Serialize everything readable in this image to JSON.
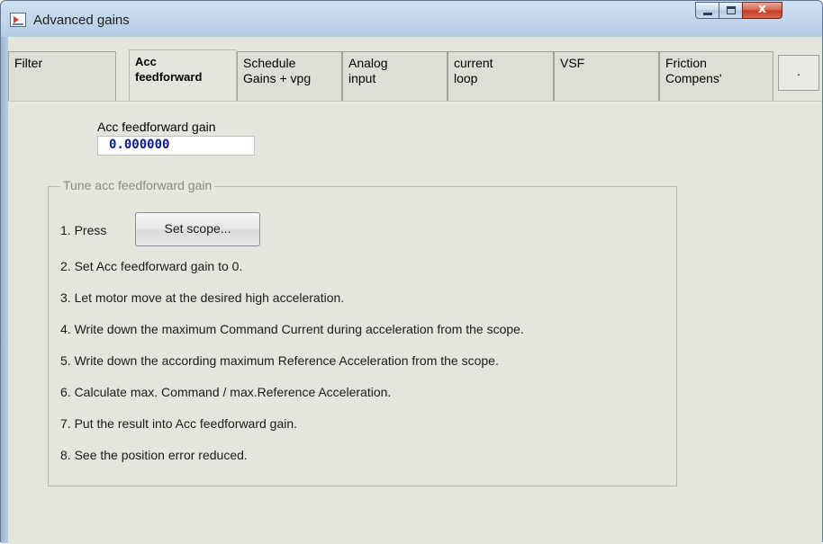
{
  "window": {
    "title": "Advanced gains"
  },
  "controls": {
    "close_glyph": "x"
  },
  "tabs": [
    {
      "label": "Filter"
    },
    {
      "label": "Acc\nfeedforward"
    },
    {
      "label": "Schedule\nGains + vpg"
    },
    {
      "label": "Analog\ninput"
    },
    {
      "label": "current\nloop"
    },
    {
      "label": "VSF"
    },
    {
      "label": "Friction\nCompens'"
    }
  ],
  "tab_scroll_label": ".",
  "acc_feedforward": {
    "gain_label": "Acc feedforward gain",
    "gain_value": "0.000000"
  },
  "tune_group": {
    "title": "Tune acc feedforward gain",
    "step1_prefix": "1. Press",
    "set_scope_button": "Set scope...",
    "steps": [
      "2. Set Acc feedforward gain to 0.",
      "3. Let motor move at the desired high acceleration.",
      "4. Write down the maximum Command Current during acceleration from the scope.",
      "5. Write down the according maximum Reference Acceleration from the scope.",
      "6. Calculate max. Command / max.Reference Acceleration.",
      "7. Put the result into Acc feedforward gain.",
      "8. See the position error reduced."
    ]
  }
}
